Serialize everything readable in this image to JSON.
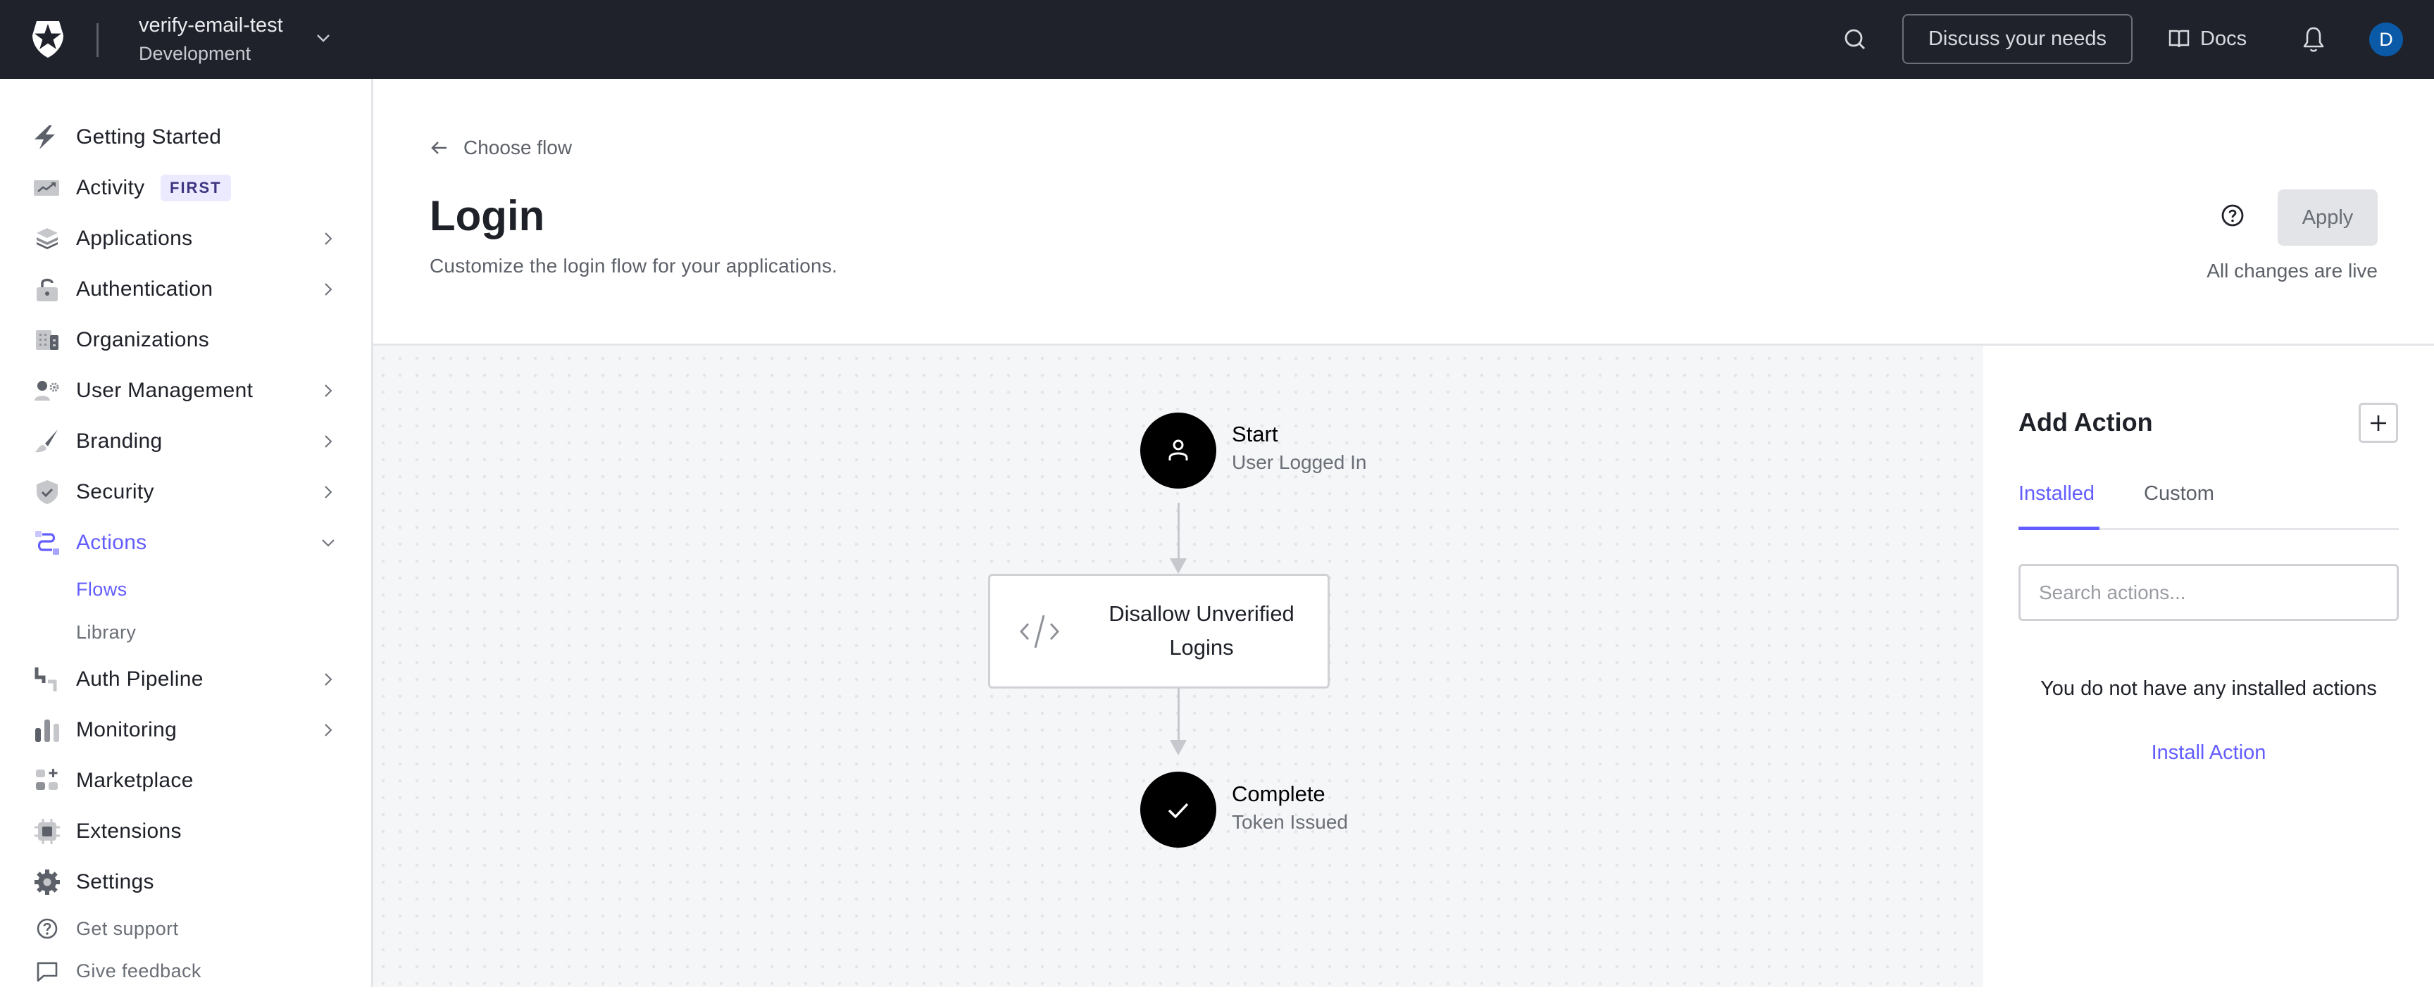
{
  "topbar": {
    "tenant_name": "verify-email-test",
    "tenant_env": "Development",
    "discuss_label": "Discuss your needs",
    "docs_label": "Docs",
    "avatar_initial": "D",
    "avatar_color": "#0a5aa8"
  },
  "sidebar": {
    "items": [
      {
        "label": "Getting Started",
        "icon": "lightning-icon"
      },
      {
        "label": "Activity",
        "icon": "activity-chart-icon",
        "badge": "FIRST"
      },
      {
        "label": "Applications",
        "icon": "layers-icon",
        "has_chevron": true
      },
      {
        "label": "Authentication",
        "icon": "unlock-icon",
        "has_chevron": true
      },
      {
        "label": "Organizations",
        "icon": "building-icon"
      },
      {
        "label": "User Management",
        "icon": "user-gear-icon",
        "has_chevron": true
      },
      {
        "label": "Branding",
        "icon": "paintbrush-icon",
        "has_chevron": true
      },
      {
        "label": "Security",
        "icon": "shield-check-icon",
        "has_chevron": true
      },
      {
        "label": "Actions",
        "icon": "actions-flow-icon",
        "has_chevron": true,
        "expanded": true,
        "active": true
      },
      {
        "label": "Auth Pipeline",
        "icon": "pipe-icon",
        "has_chevron": true
      },
      {
        "label": "Monitoring",
        "icon": "bar-chart-icon",
        "has_chevron": true
      },
      {
        "label": "Marketplace",
        "icon": "grid-plus-icon"
      },
      {
        "label": "Extensions",
        "icon": "chip-icon"
      },
      {
        "label": "Settings",
        "icon": "gear-icon"
      }
    ],
    "actions_subitems": [
      {
        "label": "Flows",
        "active": true
      },
      {
        "label": "Library",
        "active": false
      }
    ],
    "utility": [
      {
        "label": "Get support",
        "icon": "help-circle-icon"
      },
      {
        "label": "Give feedback",
        "icon": "chat-bubble-icon"
      }
    ],
    "accent_color": "#635dff"
  },
  "page": {
    "back_label": "Choose flow",
    "title": "Login",
    "subtitle": "Customize the login flow for your applications.",
    "apply_label": "Apply",
    "status_text": "All changes are live"
  },
  "flow": {
    "start": {
      "title": "Start",
      "subtitle": "User Logged In"
    },
    "actions": [
      {
        "label": "Disallow Unverified Logins"
      }
    ],
    "complete": {
      "title": "Complete",
      "subtitle": "Token Issued"
    }
  },
  "panel": {
    "title": "Add Action",
    "tabs": [
      {
        "label": "Installed",
        "active": true
      },
      {
        "label": "Custom",
        "active": false
      }
    ],
    "search_placeholder": "Search actions...",
    "search_value": "",
    "empty_message": "You do not have any installed actions",
    "install_link": "Install Action"
  }
}
